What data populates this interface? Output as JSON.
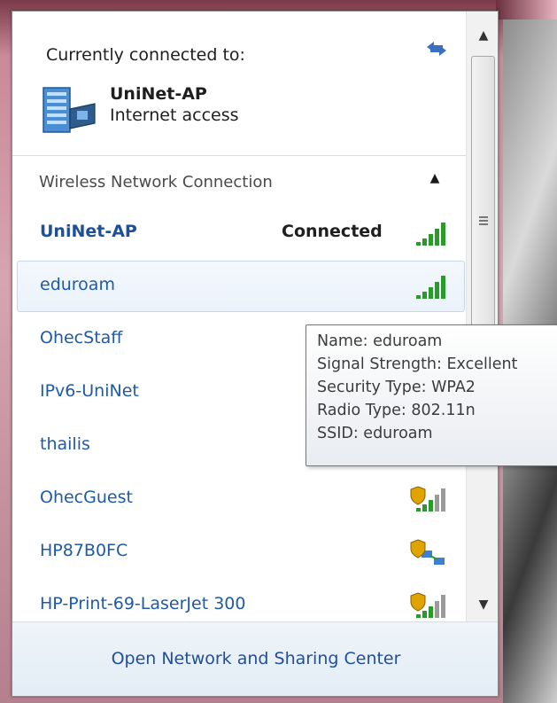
{
  "connected": {
    "title": "Currently connected to:",
    "network_name": "UniNet-AP",
    "network_status": "Internet access",
    "icons": {
      "refresh": "refresh-icon",
      "computer": "network-computer-icon"
    }
  },
  "wireless": {
    "section_label": "Wireless Network Connection",
    "collapse_icon": "chevron-up-icon",
    "networks": [
      {
        "name": "UniNet-AP",
        "status": "Connected",
        "signal": "signal-full",
        "secured": false,
        "bold": true
      },
      {
        "name": "eduroam",
        "status": "",
        "signal": "signal-full",
        "secured": false
      },
      {
        "name": "OhecStaff",
        "status": "",
        "signal": "signal-full",
        "secured": false
      },
      {
        "name": "IPv6-UniNet",
        "status": "",
        "signal": "signal-full",
        "secured": false
      },
      {
        "name": "thailis",
        "status": "",
        "signal": "signal-full",
        "secured": false
      },
      {
        "name": "OhecGuest",
        "status": "",
        "signal": "signal-shield",
        "secured": true
      },
      {
        "name": "HP87B0FC",
        "status": "",
        "signal": "adhoc-shield",
        "secured": true
      },
      {
        "name": "HP-Print-69-LaserJet 300",
        "status": "",
        "signal": "signal-shield",
        "secured": true
      }
    ]
  },
  "tooltip": {
    "lines": [
      "Name: eduroam",
      "Signal Strength: Excellent",
      "Security Type: WPA2",
      "Radio Type: 802.11n",
      "SSID: eduroam"
    ]
  },
  "footer": {
    "link_label": "Open Network and Sharing Center"
  },
  "colors": {
    "link": "#1f5aa6",
    "signal_green": "#2a9a2a",
    "signal_gray": "#9a9a9a",
    "shield_gold": "#e0a400",
    "hover_bg": "#eaf2fb"
  }
}
